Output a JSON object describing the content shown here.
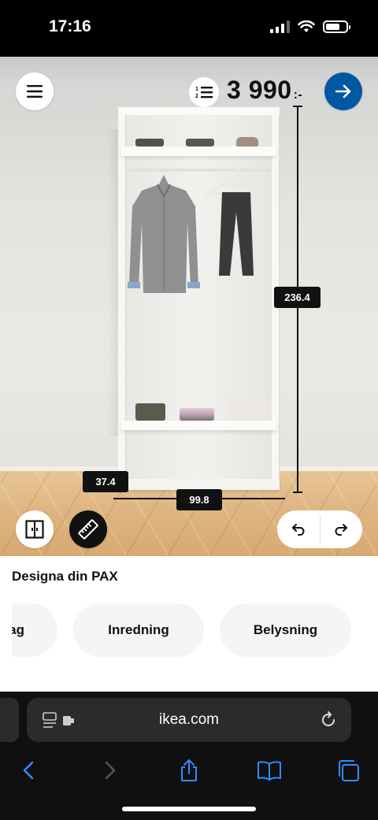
{
  "status_bar": {
    "time": "17:16"
  },
  "header": {
    "price": "3 990",
    "price_suffix": ":-"
  },
  "dimensions": {
    "height": "236.4",
    "depth": "37.4",
    "width": "99.8"
  },
  "panel": {
    "title": "Designa din PAX",
    "tabs": [
      {
        "label": "ag"
      },
      {
        "label": "Inredning"
      },
      {
        "label": "Belysning"
      }
    ]
  },
  "browser": {
    "url": "ikea.com"
  },
  "colors": {
    "accent": "#0058a3",
    "dark": "#111111"
  },
  "icons": [
    "hamburger-menu-icon",
    "numbered-list-icon",
    "arrow-right-icon",
    "door-icon",
    "ruler-icon",
    "undo-icon",
    "redo-icon",
    "reader-icon",
    "reload-icon",
    "back-icon",
    "forward-icon",
    "share-icon",
    "bookmarks-icon",
    "tabs-icon"
  ]
}
